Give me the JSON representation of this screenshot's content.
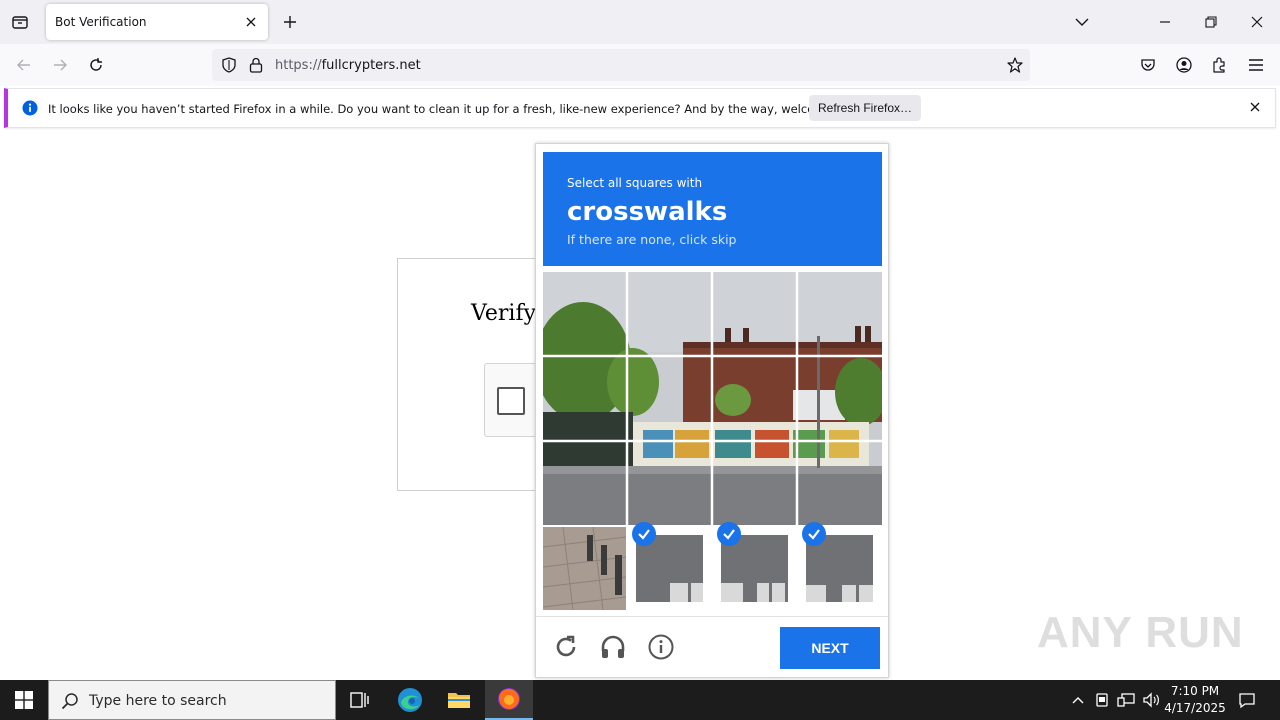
{
  "browser": {
    "tab_title": "Bot Verification",
    "url_prefix": "https://",
    "url_domain": "fullcrypters.net"
  },
  "notification": {
    "text": "It looks like you haven’t started Firefox in a while. Do you want to clean it up for a fresh, like-new experience? And by the way, welcome back!",
    "button_label": "Refresh Firefox…"
  },
  "page": {
    "verify_text": "Verifyi"
  },
  "captcha": {
    "instruction": "Select all squares with",
    "keyword": "crosswalks",
    "subtext": "If there are none, click skip",
    "selected_tiles": [
      1,
      2,
      3
    ],
    "next_label": "NEXT",
    "accent_color": "#1a73e8"
  },
  "watermark": "ANY RUN",
  "taskbar": {
    "search_placeholder": "Type here to search",
    "time": "7:10 PM",
    "date": "4/17/2025"
  }
}
